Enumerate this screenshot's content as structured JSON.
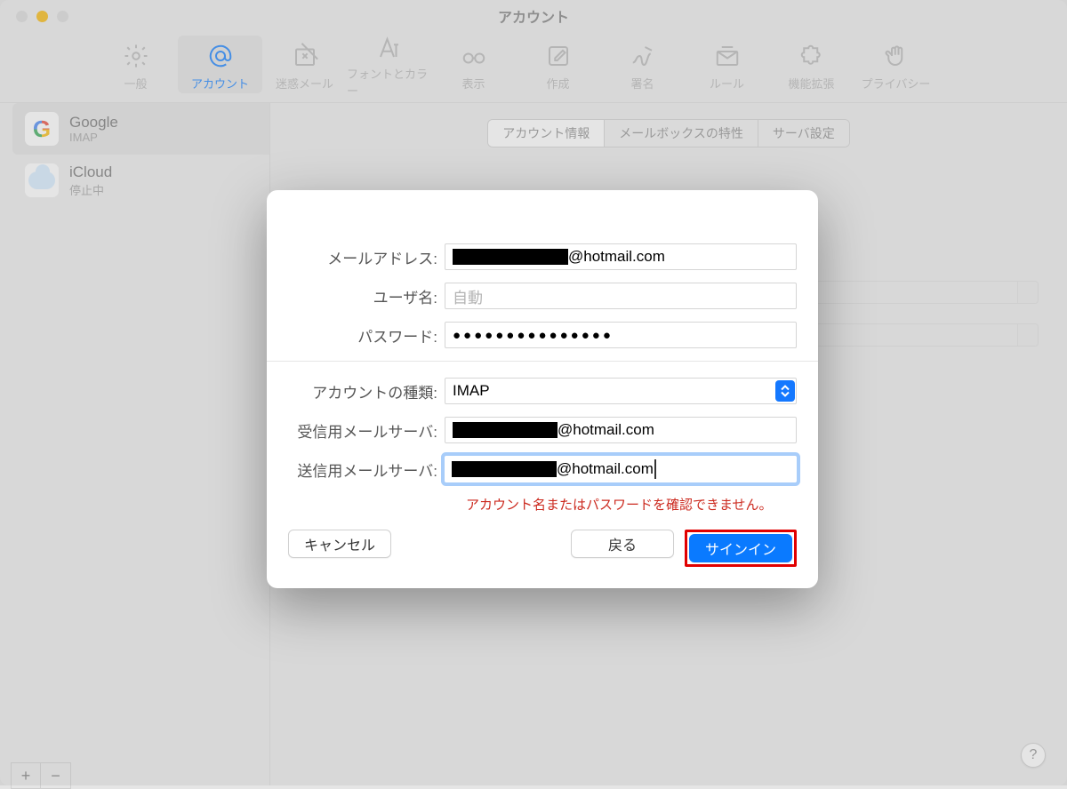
{
  "window": {
    "title": "アカウント"
  },
  "toolbar": [
    {
      "id": "general",
      "label": "一般"
    },
    {
      "id": "accounts",
      "label": "アカウント"
    },
    {
      "id": "junk",
      "label": "迷惑メール"
    },
    {
      "id": "fonts",
      "label": "フォントとカラー"
    },
    {
      "id": "viewing",
      "label": "表示"
    },
    {
      "id": "compose",
      "label": "作成"
    },
    {
      "id": "signatures",
      "label": "署名"
    },
    {
      "id": "rules",
      "label": "ルール"
    },
    {
      "id": "extensions",
      "label": "機能拡張"
    },
    {
      "id": "privacy",
      "label": "プライバシー"
    }
  ],
  "toolbar_selected": "accounts",
  "sidebar": {
    "accounts": [
      {
        "name": "Google",
        "sub": "IMAP",
        "icon": "google",
        "selected": true
      },
      {
        "name": "iCloud",
        "sub": "停止中",
        "icon": "icloud",
        "selected": false
      }
    ],
    "buttons": {
      "add": "+",
      "remove": "−"
    }
  },
  "segments": [
    {
      "id": "info",
      "label": "アカウント情報",
      "selected": true
    },
    {
      "id": "mailbox",
      "label": "メールボックスの特性",
      "selected": false
    },
    {
      "id": "server",
      "label": "サーバ設定",
      "selected": false
    }
  ],
  "background_form": {
    "selects": [
      {
        "value": ">"
      },
      {
        "value": ""
      }
    ]
  },
  "dialog": {
    "fields": {
      "email": {
        "label": "メールアドレス",
        "suffix": "@hotmail.com"
      },
      "username": {
        "label": "ユーザ名",
        "placeholder": "自動",
        "value": ""
      },
      "password": {
        "label": "パスワード",
        "masked_length": 15
      },
      "account_type": {
        "label": "アカウントの種類",
        "value": "IMAP"
      },
      "incoming": {
        "label": "受信用メールサーバ",
        "suffix": "@hotmail.com"
      },
      "outgoing": {
        "label": "送信用メールサーバ",
        "suffix": "@hotmail.com",
        "focused": true
      }
    },
    "error": "アカウント名またはパスワードを確認できません。",
    "buttons": {
      "cancel": "キャンセル",
      "back": "戻る",
      "signin": "サインイン"
    }
  },
  "help": "?"
}
